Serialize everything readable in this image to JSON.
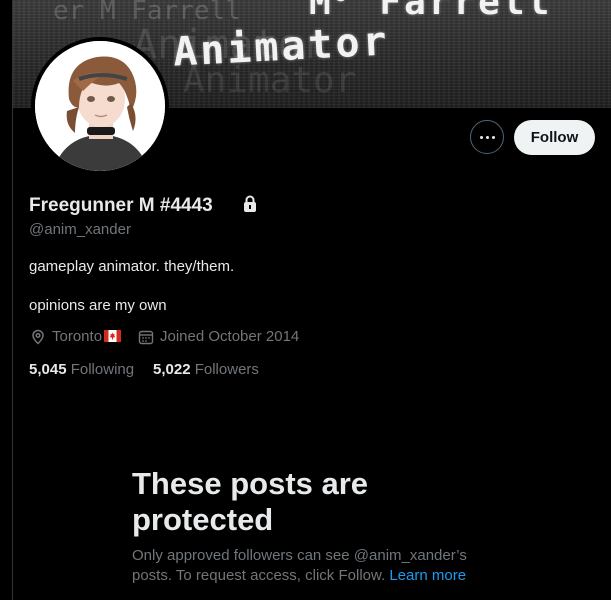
{
  "banner": {
    "line1": "M",
    "line1_sup": "c",
    "line1_tail": "Farrell",
    "line2": "Animator",
    "ghost1": "er M  Farrell",
    "ghost2": "Animator",
    "ghost3": "Animator"
  },
  "profile": {
    "display_name": "Freegunner M #4443",
    "handle": "@anim_xander",
    "bio_line1": "gameplay animator. they/them.",
    "bio_line2": "opinions are my own",
    "location": "Toronto",
    "joined": "Joined October 2014",
    "following_count": "5,045",
    "following_label": "Following",
    "followers_count": "5,022",
    "followers_label": "Followers"
  },
  "actions": {
    "follow_label": "Follow"
  },
  "protected": {
    "title_line1": "These posts are",
    "title_line2": "protected",
    "body": "Only approved followers can see @anim_xander’s posts. To request access, click Follow. ",
    "learn_more": "Learn more"
  },
  "icons": {
    "more": "more-options-icon",
    "lock": "lock-icon",
    "location": "location-pin-icon",
    "calendar": "calendar-icon",
    "flag": "canada-flag-icon"
  },
  "colors": {
    "background": "#000000",
    "text_primary": "#e7e9ea",
    "text_secondary": "#71767b",
    "link": "#1d9bf0",
    "follow_button_bg": "#eff3f4",
    "border": "#536471"
  }
}
